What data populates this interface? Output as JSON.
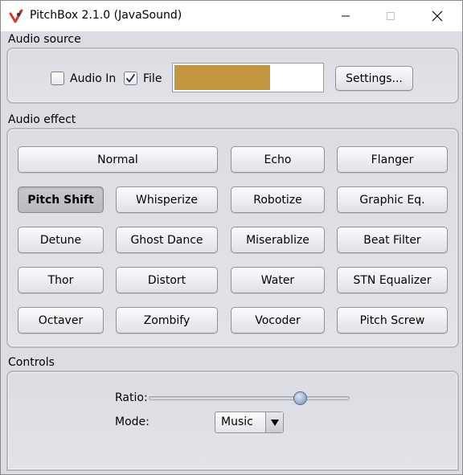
{
  "window": {
    "title": "PitchBox 2.1.0 (JavaSound)"
  },
  "audio_source": {
    "label": "Audio source",
    "audio_in": {
      "label": "Audio In",
      "checked": false
    },
    "file": {
      "label": "File",
      "checked": true
    },
    "level_fraction": 0.65,
    "level_color": "#c3963f",
    "settings_label": "Settings..."
  },
  "audio_effect": {
    "label": "Audio effect",
    "selected": "Pitch Shift",
    "buttons": {
      "normal": "Normal",
      "echo": "Echo",
      "flanger": "Flanger",
      "pitch_shift": "Pitch Shift",
      "whisperize": "Whisperize",
      "robotize": "Robotize",
      "graphic_eq": "Graphic Eq.",
      "detune": "Detune",
      "ghost_dance": "Ghost Dance",
      "miserablize": "Miserablize",
      "beat_filter": "Beat Filter",
      "thor": "Thor",
      "distort": "Distort",
      "water": "Water",
      "stn_equalizer": "STN Equalizer",
      "octaver": "Octaver",
      "zombify": "Zombify",
      "vocoder": "Vocoder",
      "pitch_screw": "Pitch Screw"
    }
  },
  "controls": {
    "label": "Controls",
    "ratio_label": "Ratio:",
    "ratio_value_fraction": 0.78,
    "mode_label": "Mode:",
    "mode_value": "Music"
  },
  "icons": {
    "app": "pitchbox-app-icon",
    "minimize": "minimize-icon",
    "maximize": "maximize-icon",
    "close": "close-icon"
  }
}
